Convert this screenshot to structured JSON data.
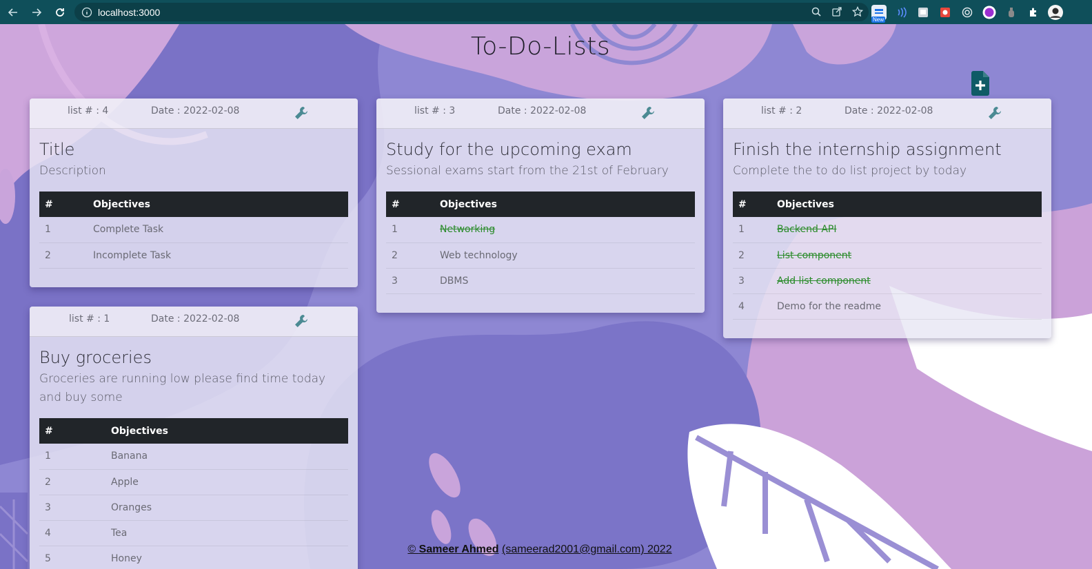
{
  "browser": {
    "url": "localhost:3000",
    "extension_badge": "New"
  },
  "page": {
    "title": "To-Do-Lists"
  },
  "cards": [
    {
      "list_no": "list # : 4",
      "date": "Date : 2022-02-08",
      "title": "Title",
      "description": "Description",
      "col_num": "#",
      "col_obj": "Objectives",
      "rows": [
        {
          "n": "1",
          "text": "Complete Task",
          "done": false
        },
        {
          "n": "2",
          "text": "Incomplete Task",
          "done": false
        }
      ]
    },
    {
      "list_no": "list # : 3",
      "date": "Date : 2022-02-08",
      "title": "Study for the upcoming exam",
      "description": "Sessional exams start from the 21st of February",
      "col_num": "#",
      "col_obj": "Objectives",
      "rows": [
        {
          "n": "1",
          "text": "Networking",
          "done": true
        },
        {
          "n": "2",
          "text": "Web technology",
          "done": false
        },
        {
          "n": "3",
          "text": "DBMS",
          "done": false
        }
      ]
    },
    {
      "list_no": "list # : 2",
      "date": "Date : 2022-02-08",
      "title": "Finish the internship assignment",
      "description": "Complete the to do list project by today",
      "col_num": "#",
      "col_obj": "Objectives",
      "rows": [
        {
          "n": "1",
          "text": "Backend API",
          "done": true
        },
        {
          "n": "2",
          "text": "List component",
          "done": true
        },
        {
          "n": "3",
          "text": "Add list component",
          "done": true
        },
        {
          "n": "4",
          "text": "Demo for the readme",
          "done": false
        }
      ]
    },
    {
      "list_no": "list # : 1",
      "date": "Date : 2022-02-08",
      "title": "Buy groceries",
      "description": "Groceries are running low please find time today and buy some",
      "col_num": "#",
      "col_obj": "Objectives",
      "rows": [
        {
          "n": "1",
          "text": "Banana",
          "done": false
        },
        {
          "n": "2",
          "text": "Apple",
          "done": false
        },
        {
          "n": "3",
          "text": "Oranges",
          "done": false
        },
        {
          "n": "4",
          "text": "Tea",
          "done": false
        },
        {
          "n": "5",
          "text": "Honey",
          "done": false
        }
      ]
    }
  ],
  "footer": {
    "prefix": "© ",
    "author": "Sameer Ahmed",
    "email": "(sameerad2001@gmail.com)",
    "year": "2022"
  },
  "icons": {
    "add": "file-plus-icon",
    "edit": "wrench-icon"
  },
  "colors": {
    "chrome": "#0f4f5a",
    "table_header": "#212529",
    "done_text": "#2a8b2a",
    "add_icon": "#0f5b66"
  }
}
